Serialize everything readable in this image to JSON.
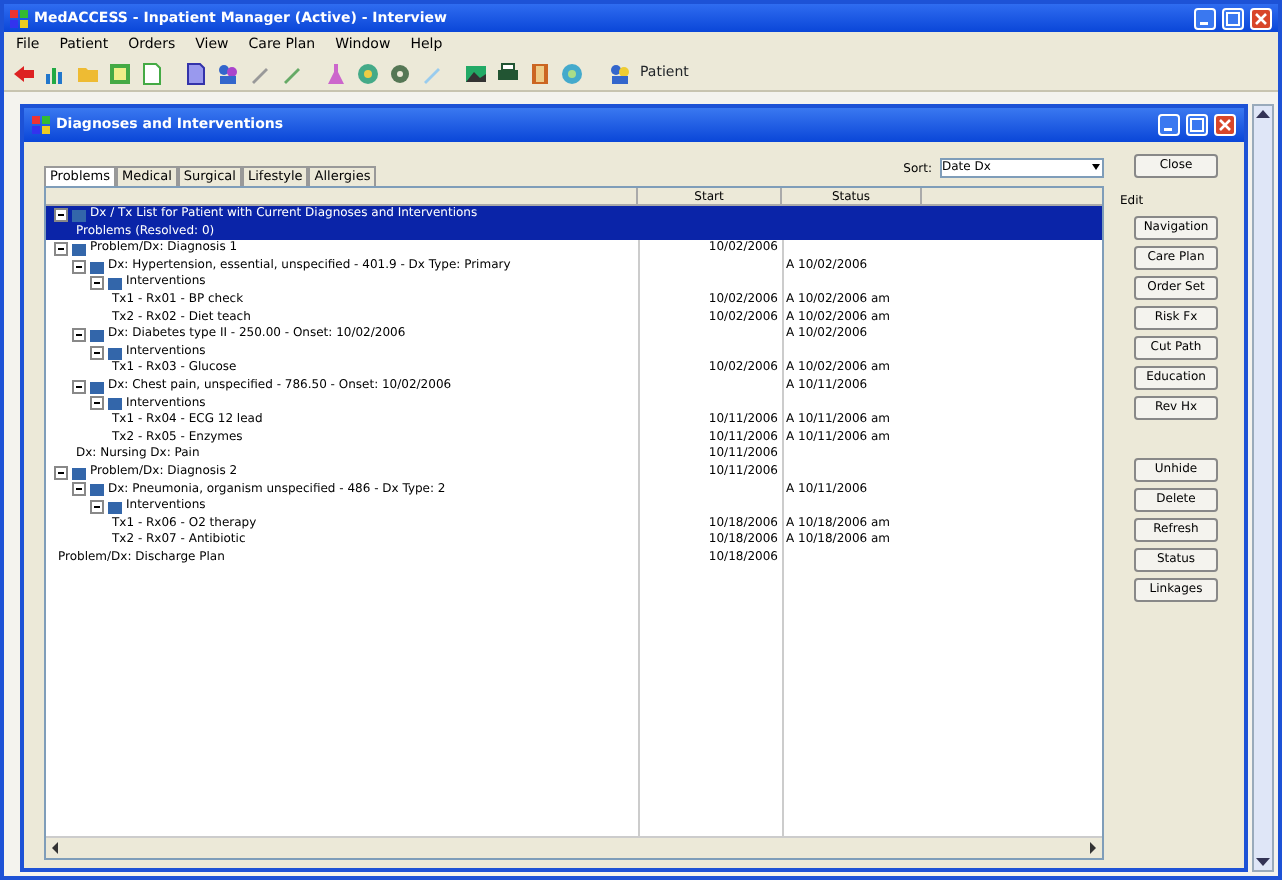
{
  "window": {
    "title": "MedACCESS - Inpatient Manager (Active) - Interview"
  },
  "menu": [
    "File",
    "Patient",
    "Orders",
    "View",
    "Care Plan",
    "Window",
    "Help"
  ],
  "toolbar": {
    "patient_button": "Patient"
  },
  "dialog": {
    "title": "Diagnoses and Interventions",
    "tabs": [
      {
        "label": "Problems",
        "selected": true
      },
      {
        "label": "Medical",
        "selected": false
      },
      {
        "label": "Surgical",
        "selected": false
      },
      {
        "label": "Lifestyle",
        "selected": false
      },
      {
        "label": "Allergies",
        "selected": false
      }
    ],
    "sort": {
      "label": "Sort:",
      "value": "Date Dx"
    },
    "columns": [
      "Start",
      "Status"
    ],
    "tree": [
      {
        "label": "Dx / Tx List for Patient with Current Diagnoses and Interventions",
        "selected": true,
        "children": [
          {
            "label": "Problems (Resolved: 0)",
            "selected": true
          }
        ]
      },
      {
        "label": "Problem/Dx: Diagnosis 1",
        "start": "10/02/2006",
        "selected": false,
        "children": [
          {
            "label": "Dx: Hypertension, essential, unspecified - 401.9 - Dx Type: Primary",
            "status": "A 10/02/2006",
            "selected": false,
            "children": [
              {
                "label": "Interventions",
                "selected": false,
                "children": [
                  {
                    "label": "Tx1 - Rx01 - BP check",
                    "start": "10/02/2006",
                    "status": "A 10/02/2006 am",
                    "selected": false
                  },
                  {
                    "label": "Tx2 - Rx02 - Diet teach",
                    "start": "10/02/2006",
                    "status": "A 10/02/2006 am",
                    "selected": false
                  }
                ]
              }
            ]
          },
          {
            "label": "Dx: Diabetes type II - 250.00 - Onset: 10/02/2006",
            "status": "A 10/02/2006",
            "selected": false,
            "children": [
              {
                "label": "Interventions",
                "selected": false,
                "children": [
                  {
                    "label": "Tx1 - Rx03 - Glucose",
                    "start": "10/02/2006",
                    "status": "A 10/02/2006 am",
                    "selected": false
                  }
                ]
              }
            ]
          },
          {
            "label": "Dx: Chest pain, unspecified - 786.50 - Onset: 10/02/2006",
            "status": "A 10/11/2006",
            "selected": false,
            "children": [
              {
                "label": "Interventions",
                "selected": false,
                "children": [
                  {
                    "label": "Tx1 - Rx04 - ECG 12 lead",
                    "start": "10/11/2006",
                    "status": "A 10/11/2006 am",
                    "selected": false
                  },
                  {
                    "label": "Tx2 - Rx05 - Enzymes",
                    "start": "10/11/2006",
                    "status": "A 10/11/2006 am",
                    "selected": false
                  }
                ]
              }
            ]
          },
          {
            "label": "Dx: Nursing Dx: Pain",
            "start": "10/11/2006",
            "selected": false
          }
        ]
      },
      {
        "label": "Problem/Dx: Diagnosis 2",
        "start": "10/11/2006",
        "selected": false,
        "children": [
          {
            "label": "Dx: Pneumonia, organism unspecified - 486 - Dx Type: 2",
            "status": "A 10/11/2006",
            "selected": false,
            "children": [
              {
                "label": "Interventions",
                "selected": false,
                "children": [
                  {
                    "label": "Tx1 - Rx06 - O2 therapy",
                    "start": "10/18/2006",
                    "status": "A 10/18/2006 am",
                    "selected": false
                  },
                  {
                    "label": "Tx2 - Rx07 - Antibiotic",
                    "start": "10/18/2006",
                    "status": "A 10/18/2006 am",
                    "selected": false
                  }
                ]
              }
            ]
          }
        ]
      },
      {
        "label": "Problem/Dx: Discharge Plan",
        "start": "10/18/2006",
        "selected": false
      }
    ],
    "buttons_top": [
      "Close"
    ],
    "group_label": "Edit",
    "buttons_edit": [
      "Navigation",
      "Care Plan",
      "Order Set",
      "Risk Fx",
      "Cut Path",
      "Education",
      "Rev Hx"
    ],
    "buttons_bottom": [
      "Unhide",
      "Delete",
      "Refresh",
      "Status",
      "Linkages"
    ]
  }
}
